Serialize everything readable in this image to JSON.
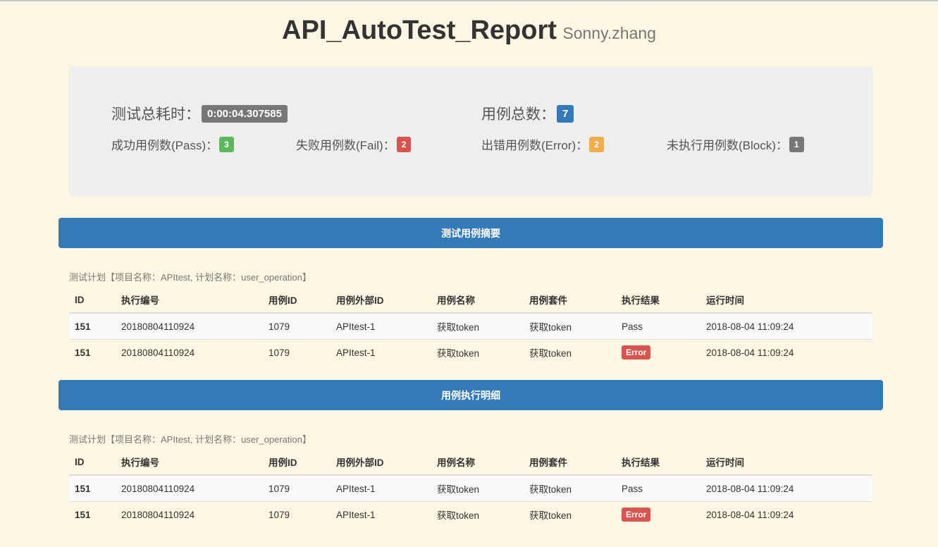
{
  "header": {
    "title": "API_AutoTest_Report",
    "subtitle": "Sonny.zhang"
  },
  "summary": {
    "total_time_label": "测试总耗时：",
    "total_time_value": "0:00:04.307585",
    "total_cases_label": "用例总数：",
    "total_cases_value": "7",
    "pass_label": "成功用例数(Pass)：",
    "pass_value": "3",
    "fail_label": "失败用例数(Fail)：",
    "fail_value": "2",
    "error_label": "出错用例数(Error)：",
    "error_value": "2",
    "block_label": "未执行用例数(Block)：",
    "block_value": "1"
  },
  "colors": {
    "background": "#fdf6e3",
    "primary": "#337ab7",
    "success": "#5cb85c",
    "danger": "#d9534f",
    "warning": "#f0ad4e",
    "default": "#777777"
  },
  "sections": [
    {
      "title": "测试用例摘要",
      "plan": "测试计划【项目名称：APItest, 计划名称：user_operation】",
      "columns": [
        "ID",
        "执行编号",
        "用例ID",
        "用例外部ID",
        "用例名称",
        "用例套件",
        "执行结果",
        "运行时间"
      ],
      "rows": [
        {
          "id": "151",
          "exec_no": "20180804110924",
          "case_id": "1079",
          "ext_id": "APItest-1",
          "name": "获取token",
          "suite": "获取token",
          "result": "Pass",
          "time": "2018-08-04 11:09:24"
        },
        {
          "id": "151",
          "exec_no": "20180804110924",
          "case_id": "1079",
          "ext_id": "APItest-1",
          "name": "获取token",
          "suite": "获取token",
          "result": "Error",
          "time": "2018-08-04 11:09:24"
        }
      ]
    },
    {
      "title": "用例执行明细",
      "plan": "测试计划【项目名称：APItest, 计划名称：user_operation】",
      "columns": [
        "ID",
        "执行编号",
        "用例ID",
        "用例外部ID",
        "用例名称",
        "用例套件",
        "执行结果",
        "运行时间"
      ],
      "rows": [
        {
          "id": "151",
          "exec_no": "20180804110924",
          "case_id": "1079",
          "ext_id": "APItest-1",
          "name": "获取token",
          "suite": "获取token",
          "result": "Pass",
          "time": "2018-08-04 11:09:24"
        },
        {
          "id": "151",
          "exec_no": "20180804110924",
          "case_id": "1079",
          "ext_id": "APItest-1",
          "name": "获取token",
          "suite": "获取token",
          "result": "Error",
          "time": "2018-08-04 11:09:24"
        }
      ]
    }
  ]
}
